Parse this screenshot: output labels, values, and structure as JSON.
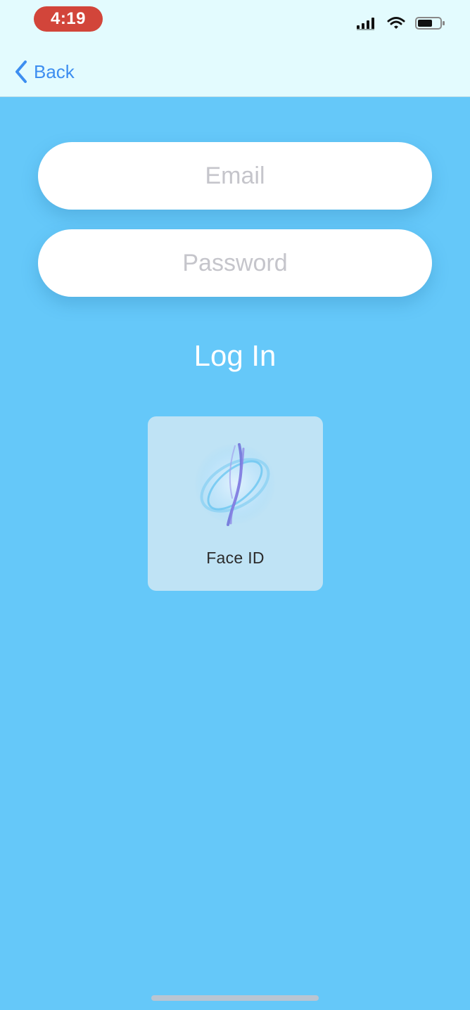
{
  "status_bar": {
    "time": "4:19",
    "icons": [
      "cellular-signal-icon",
      "wifi-icon",
      "battery-icon"
    ],
    "time_pill_color": "#d2453a"
  },
  "nav": {
    "back_label": "Back",
    "back_icon": "chevron-left-icon",
    "accent_color": "#3d8ef0"
  },
  "form": {
    "email_placeholder": "Email",
    "password_placeholder": "Password",
    "login_label": "Log In"
  },
  "face_id": {
    "label": "Face ID",
    "icon": "face-id-animation-icon"
  },
  "colors": {
    "background": "#65c8f9",
    "top_bar": "#e3fbfe"
  }
}
